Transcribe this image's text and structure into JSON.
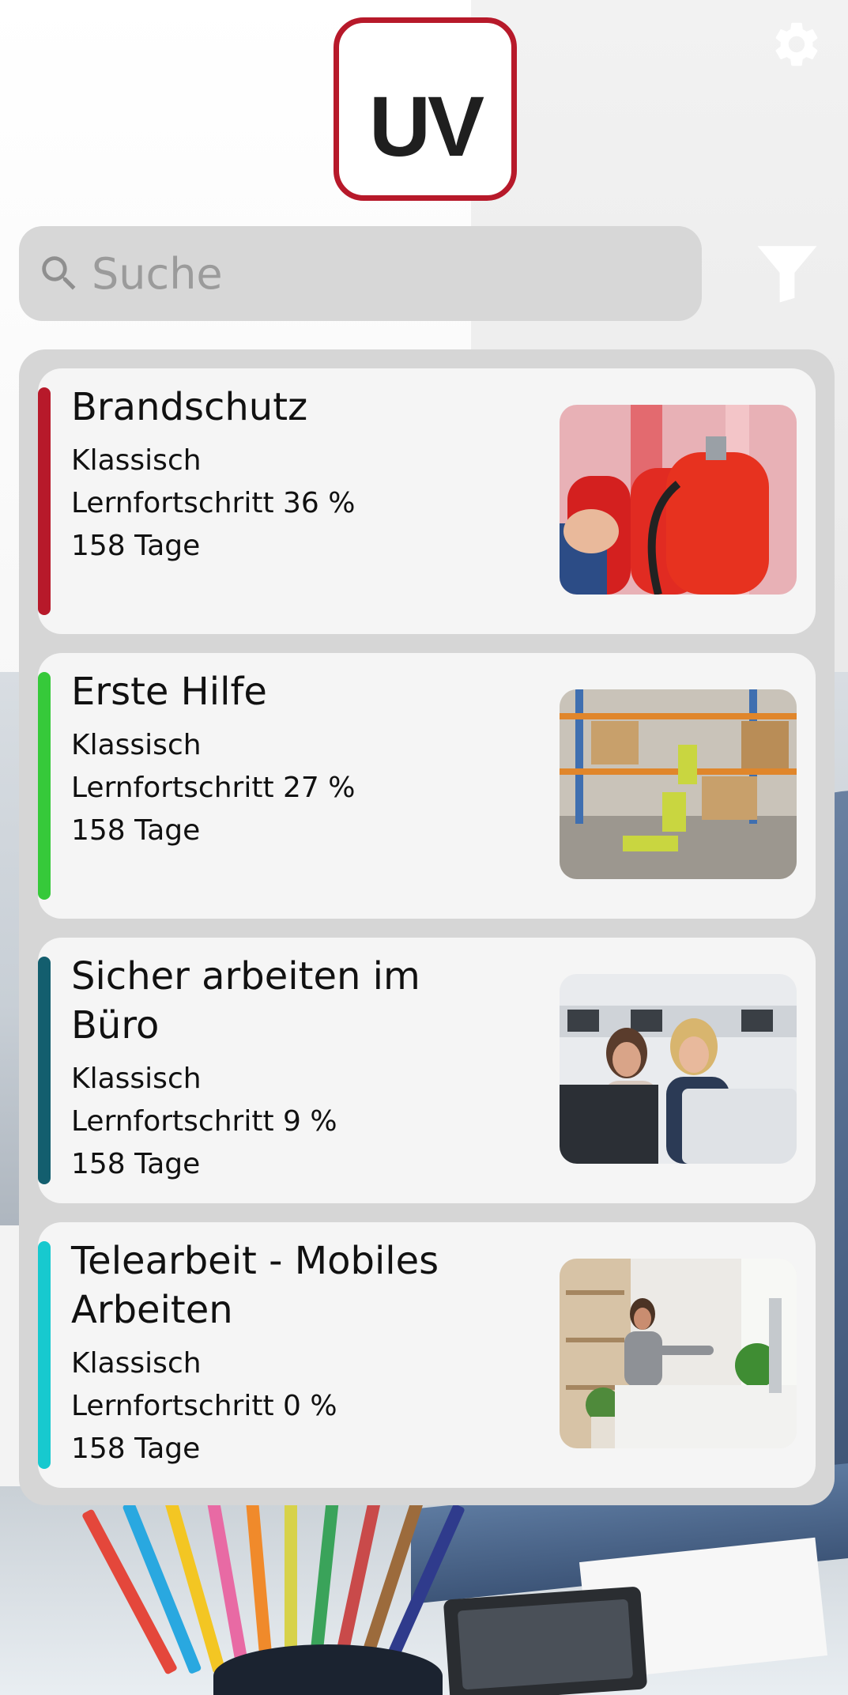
{
  "app": {
    "logo_text": "UV",
    "brand_color": "#b7192a"
  },
  "search": {
    "placeholder": "Suche",
    "value": ""
  },
  "icons": {
    "settings": "gear-icon",
    "search": "search-icon",
    "filter": "filter-icon"
  },
  "courses": [
    {
      "title": "Brandschutz",
      "type": "Klassisch",
      "progress_text": "Lernfortschritt 36 %",
      "progress": 36,
      "days": "158 Tage",
      "accent": "#b7192a",
      "image": "fire-extinguishers-photo"
    },
    {
      "title": "Erste Hilfe",
      "type": "Klassisch",
      "progress_text": "Lernfortschritt 27 %",
      "progress": 27,
      "days": "158 Tage",
      "accent": "#36c93a",
      "image": "warehouse-first-aid-photo"
    },
    {
      "title": "Sicher arbeiten im Büro",
      "type": "Klassisch",
      "progress_text": "Lernfortschritt 9 %",
      "progress": 9,
      "days": "158 Tage",
      "accent": "#135e6e",
      "image": "office-colleagues-photo"
    },
    {
      "title": "Telearbeit - Mobiles Arbeiten",
      "type": "Klassisch",
      "progress_text": "Lernfortschritt 0 %",
      "progress": 0,
      "days": "158 Tage",
      "accent": "#17c9cf",
      "image": "home-office-stretching-photo"
    }
  ]
}
